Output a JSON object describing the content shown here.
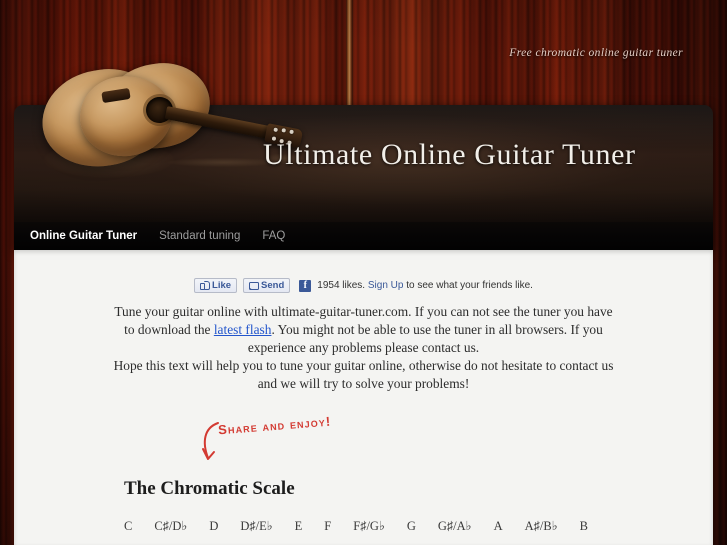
{
  "site": {
    "tagline": "Free chromatic online guitar tuner",
    "title": "Ultimate Online Guitar Tuner"
  },
  "nav": {
    "items": [
      {
        "label": "Online Guitar Tuner",
        "active": true
      },
      {
        "label": "Standard tuning",
        "active": false
      },
      {
        "label": "FAQ",
        "active": false
      }
    ]
  },
  "social": {
    "like_label": "Like",
    "send_label": "Send",
    "logo_letter": "f",
    "likes_count": "1954 likes.",
    "signup_label": "Sign Up",
    "tail_text": "to see what your friends like."
  },
  "intro": {
    "line1_pre": "Tune your guitar online with ultimate-guitar-tuner.com. If you can not see the tuner you have to download the ",
    "link_label": "latest flash",
    "line1_post": ". You might not be able to use the tuner in all browsers. If you experience any problems please contact us.",
    "line2": "Hope this text will help you to tune your guitar online, otherwise do not hesitate to contact us and we will try to solve your problems!"
  },
  "annotation": {
    "share_text": "Share and enjoy!",
    "color": "#d33a32"
  },
  "scale": {
    "heading": "The Chromatic Scale",
    "notes": [
      "C",
      "C♯/D♭",
      "D",
      "D♯/E♭",
      "E",
      "F",
      "F♯/G♭",
      "G",
      "G♯/A♭",
      "A",
      "A♯/B♭",
      "B"
    ]
  },
  "colors": {
    "wood": "#6b1608",
    "header": "#1e1410",
    "content_bg": "#f4f4f2",
    "link": "#2255cc",
    "facebook": "#3b5998"
  }
}
